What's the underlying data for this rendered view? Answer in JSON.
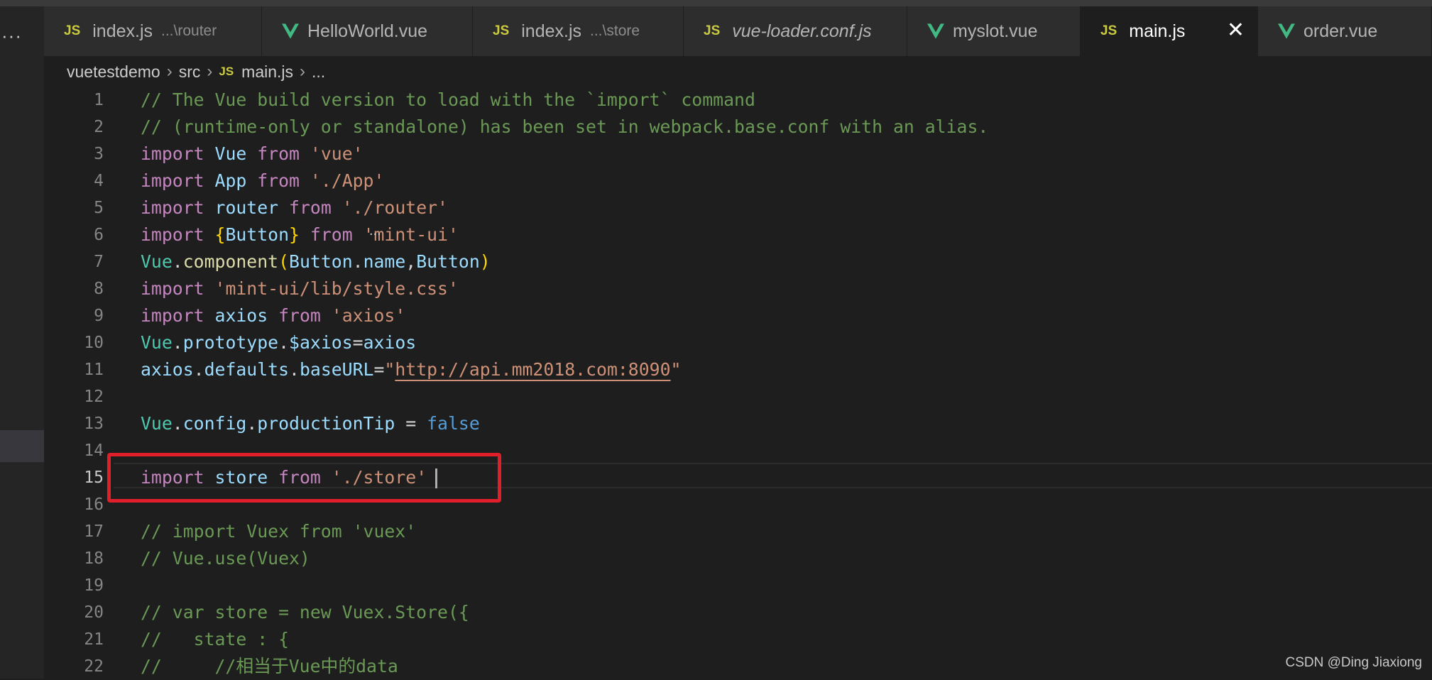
{
  "tabs": [
    {
      "name": "index.js",
      "desc": "...\\router",
      "icon": "js-icon",
      "icon_text": "JS"
    },
    {
      "name": "HelloWorld.vue",
      "desc": "",
      "icon": "vue-icon"
    },
    {
      "name": "index.js",
      "desc": "...\\store",
      "icon": "js-icon",
      "icon_text": "JS"
    },
    {
      "name": "vue-loader.conf.js",
      "desc": "",
      "icon": "js-icon",
      "icon_text": "JS",
      "italic": true
    },
    {
      "name": "myslot.vue",
      "desc": "",
      "icon": "vue-icon"
    },
    {
      "name": "main.js",
      "desc": "",
      "icon": "js-icon",
      "icon_text": "JS",
      "active": true,
      "close_glyph": "✕"
    },
    {
      "name": "order.vue",
      "desc": "",
      "icon": "vue-icon"
    }
  ],
  "breadcrumb": {
    "items": [
      "vuetestdemo",
      "src",
      "main.js",
      "..."
    ],
    "file_icon_text": "JS",
    "separator": "›"
  },
  "activity_bar": {
    "more_glyph": "···"
  },
  "editor": {
    "current_line": 15,
    "lines": [
      {
        "n": "1",
        "tokens": [
          [
            "// The Vue build version to load with the `import` command",
            "comment"
          ]
        ]
      },
      {
        "n": "2",
        "tokens": [
          [
            "// (runtime-only or standalone) has been set in webpack.base.conf with an alias.",
            "comment"
          ]
        ]
      },
      {
        "n": "3",
        "tokens": [
          [
            "import",
            "keyword"
          ],
          [
            " ",
            "punct"
          ],
          [
            "Vue",
            "var"
          ],
          [
            " ",
            "punct"
          ],
          [
            "from",
            "keyword"
          ],
          [
            " ",
            "punct"
          ],
          [
            "'vue'",
            "string"
          ]
        ]
      },
      {
        "n": "4",
        "tokens": [
          [
            "import",
            "keyword"
          ],
          [
            " ",
            "punct"
          ],
          [
            "App",
            "var"
          ],
          [
            " ",
            "punct"
          ],
          [
            "from",
            "keyword"
          ],
          [
            " ",
            "punct"
          ],
          [
            "'./App'",
            "string"
          ]
        ]
      },
      {
        "n": "5",
        "tokens": [
          [
            "import",
            "keyword"
          ],
          [
            " ",
            "punct"
          ],
          [
            "router",
            "var"
          ],
          [
            " ",
            "punct"
          ],
          [
            "from",
            "keyword"
          ],
          [
            " ",
            "punct"
          ],
          [
            "'./router'",
            "string"
          ]
        ]
      },
      {
        "n": "6",
        "tokens": [
          [
            "import",
            "keyword"
          ],
          [
            " ",
            "punct"
          ],
          [
            "{",
            "bracket"
          ],
          [
            "Button",
            "var"
          ],
          [
            "}",
            "bracket"
          ],
          [
            " ",
            "punct"
          ],
          [
            "from",
            "keyword"
          ],
          [
            " ",
            "punct"
          ],
          [
            "'mint-ui'",
            "string"
          ]
        ]
      },
      {
        "n": "7",
        "tokens": [
          [
            "Vue",
            "class"
          ],
          [
            ".",
            "punct"
          ],
          [
            "component",
            "func"
          ],
          [
            "(",
            "bracket"
          ],
          [
            "Button",
            "var"
          ],
          [
            ".",
            "punct"
          ],
          [
            "name",
            "var"
          ],
          [
            ",",
            "punct"
          ],
          [
            "Button",
            "var"
          ],
          [
            ")",
            "bracket"
          ]
        ]
      },
      {
        "n": "8",
        "tokens": [
          [
            "import",
            "keyword"
          ],
          [
            " ",
            "punct"
          ],
          [
            "'mint-ui/lib/style.css'",
            "string"
          ]
        ]
      },
      {
        "n": "9",
        "tokens": [
          [
            "import",
            "keyword"
          ],
          [
            " ",
            "punct"
          ],
          [
            "axios",
            "var"
          ],
          [
            " ",
            "punct"
          ],
          [
            "from",
            "keyword"
          ],
          [
            " ",
            "punct"
          ],
          [
            "'axios'",
            "string"
          ]
        ]
      },
      {
        "n": "10",
        "tokens": [
          [
            "Vue",
            "class"
          ],
          [
            ".",
            "punct"
          ],
          [
            "prototype",
            "var"
          ],
          [
            ".",
            "punct"
          ],
          [
            "$axios",
            "var"
          ],
          [
            "=",
            "punct"
          ],
          [
            "axios",
            "var"
          ]
        ]
      },
      {
        "n": "11",
        "tokens": [
          [
            "axios",
            "var"
          ],
          [
            ".",
            "punct"
          ],
          [
            "defaults",
            "var"
          ],
          [
            ".",
            "punct"
          ],
          [
            "baseURL",
            "var"
          ],
          [
            "=",
            "punct"
          ],
          [
            "\"",
            "string"
          ],
          [
            "http://api.mm2018.com:8090",
            "url"
          ],
          [
            "\"",
            "string"
          ]
        ]
      },
      {
        "n": "12",
        "tokens": []
      },
      {
        "n": "13",
        "tokens": [
          [
            "Vue",
            "class"
          ],
          [
            ".",
            "punct"
          ],
          [
            "config",
            "var"
          ],
          [
            ".",
            "punct"
          ],
          [
            "productionTip",
            "var"
          ],
          [
            " = ",
            "punct"
          ],
          [
            "false",
            "bool"
          ]
        ]
      },
      {
        "n": "14",
        "tokens": []
      },
      {
        "n": "15",
        "tokens": [
          [
            "import",
            "keyword"
          ],
          [
            " ",
            "punct"
          ],
          [
            "store",
            "var"
          ],
          [
            " ",
            "punct"
          ],
          [
            "from",
            "keyword"
          ],
          [
            " ",
            "punct"
          ],
          [
            "'./store'",
            "string"
          ]
        ]
      },
      {
        "n": "16",
        "tokens": []
      },
      {
        "n": "17",
        "tokens": [
          [
            "// import Vuex from 'vuex'",
            "comment"
          ]
        ]
      },
      {
        "n": "18",
        "tokens": [
          [
            "// Vue.use(Vuex)",
            "comment"
          ]
        ]
      },
      {
        "n": "19",
        "tokens": []
      },
      {
        "n": "20",
        "tokens": [
          [
            "// var store = new Vuex.Store({",
            "comment"
          ]
        ]
      },
      {
        "n": "21",
        "tokens": [
          [
            "//   state : {",
            "comment"
          ]
        ]
      },
      {
        "n": "22",
        "tokens": [
          [
            "//     //相当于Vue中的data",
            "comment"
          ]
        ]
      }
    ]
  },
  "hint_dots": "...",
  "watermark": "CSDN @Ding Jiaxiong",
  "colors": {
    "highlight_box": "#e01f2a",
    "editor_bg": "#1e1e1e",
    "vue_green": "#42b883",
    "js_yellow": "#cbcb41"
  }
}
